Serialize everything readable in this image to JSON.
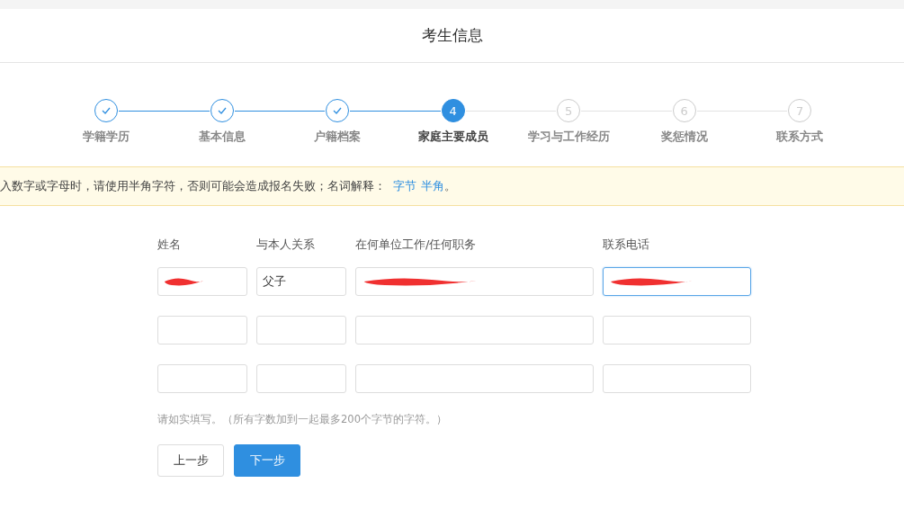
{
  "header": {
    "title": "考生信息"
  },
  "steps": [
    {
      "label": "学籍学历",
      "completed": true,
      "selected": false
    },
    {
      "label": "基本信息",
      "completed": true,
      "selected": false
    },
    {
      "label": "户籍档案",
      "completed": true,
      "selected": false
    },
    {
      "number": "4",
      "label": "家庭主要成员",
      "completed": false,
      "selected": true
    },
    {
      "number": "5",
      "label": "学习与工作经历",
      "completed": false,
      "selected": false
    },
    {
      "number": "6",
      "label": "奖惩情况",
      "completed": false,
      "selected": false
    },
    {
      "number": "7",
      "label": "联系方式",
      "completed": false,
      "selected": false
    }
  ],
  "notice": {
    "text": "入数字或字母时，请使用半角字符，否则可能会造成报名失败；名词解释：",
    "links": [
      "字节",
      "半角"
    ],
    "end": "。"
  },
  "form": {
    "columns": [
      "姓名",
      "与本人关系",
      "在何单位工作/任何职务",
      "联系电话"
    ],
    "rows": [
      [
        {
          "redacted": true,
          "focused": false
        },
        {
          "value": "父子",
          "redacted": false,
          "focused": false
        },
        {
          "redacted": true,
          "focused": false
        },
        {
          "redacted": true,
          "focused": true
        }
      ],
      [
        {
          "redacted": false,
          "focused": false
        },
        {
          "redacted": false,
          "focused": false
        },
        {
          "redacted": false,
          "focused": false
        },
        {
          "redacted": false,
          "focused": false
        }
      ],
      [
        {
          "redacted": false,
          "focused": false
        },
        {
          "redacted": false,
          "focused": false
        },
        {
          "redacted": false,
          "focused": false
        },
        {
          "redacted": false,
          "focused": false
        }
      ]
    ],
    "hint": "请如实填写。（所有字数加到一起最多200个字节的字符。）"
  },
  "buttons": [
    {
      "label": "上一步",
      "kind": "secondary"
    },
    {
      "label": "下一步",
      "kind": "primary"
    }
  ]
}
